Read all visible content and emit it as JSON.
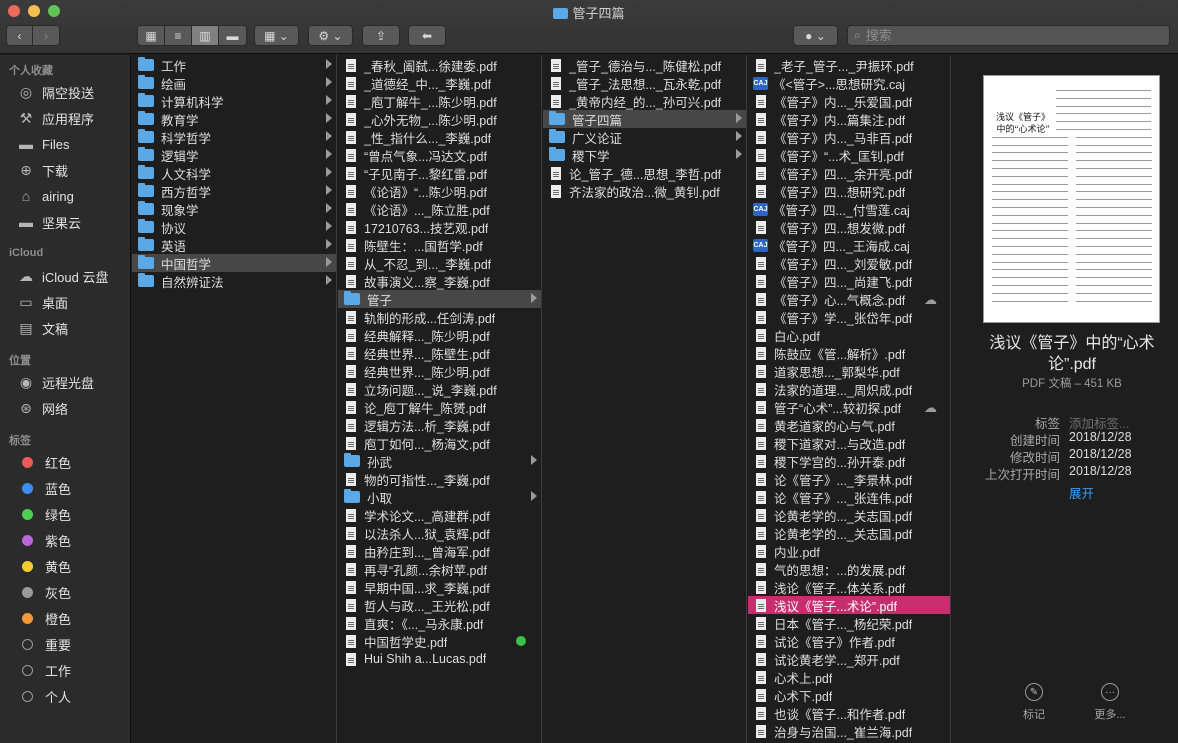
{
  "window": {
    "title": "管子四篇"
  },
  "search": {
    "placeholder": "搜索"
  },
  "sidebar": {
    "favorites_header": "个人收藏",
    "favorites": [
      {
        "label": "隔空投送",
        "icon": "airdrop-icon"
      },
      {
        "label": "应用程序",
        "icon": "applications-icon"
      },
      {
        "label": "Files",
        "icon": "folder-icon"
      },
      {
        "label": "下载",
        "icon": "downloads-icon"
      },
      {
        "label": "airing",
        "icon": "home-icon"
      },
      {
        "label": "坚果云",
        "icon": "folder-icon"
      }
    ],
    "icloud_header": "iCloud",
    "icloud": [
      {
        "label": "iCloud 云盘",
        "icon": "cloud-icon"
      },
      {
        "label": "桌面",
        "icon": "desktop-icon"
      },
      {
        "label": "文稿",
        "icon": "documents-icon"
      }
    ],
    "locations_header": "位置",
    "locations": [
      {
        "label": "远程光盘",
        "icon": "disc-icon"
      },
      {
        "label": "网络",
        "icon": "network-icon"
      }
    ],
    "tags_header": "标签",
    "tags": [
      {
        "label": "红色",
        "color": "#ec5b56"
      },
      {
        "label": "蓝色",
        "color": "#3d8ff7"
      },
      {
        "label": "绿色",
        "color": "#4fcf52"
      },
      {
        "label": "紫色",
        "color": "#b866d8"
      },
      {
        "label": "黄色",
        "color": "#f5cc30"
      },
      {
        "label": "灰色",
        "color": "#9a9a9a"
      },
      {
        "label": "橙色",
        "color": "#f29a35"
      },
      {
        "label": "重要",
        "color": ""
      },
      {
        "label": "工作",
        "color": ""
      },
      {
        "label": "个人",
        "color": ""
      }
    ]
  },
  "columns": [
    {
      "items": [
        {
          "name": "工作",
          "type": "folder"
        },
        {
          "name": "绘画",
          "type": "folder"
        },
        {
          "name": "计算机科学",
          "type": "folder"
        },
        {
          "name": "教育学",
          "type": "folder"
        },
        {
          "name": "科学哲学",
          "type": "folder"
        },
        {
          "name": "逻辑学",
          "type": "folder"
        },
        {
          "name": "人文科学",
          "type": "folder"
        },
        {
          "name": "西方哲学",
          "type": "folder"
        },
        {
          "name": "现象学",
          "type": "folder"
        },
        {
          "name": "协议",
          "type": "folder"
        },
        {
          "name": "英语",
          "type": "folder"
        },
        {
          "name": "中国哲学",
          "type": "folder",
          "selected": true
        },
        {
          "name": "自然辨证法",
          "type": "folder"
        }
      ]
    },
    {
      "items": [
        {
          "name": "_春秋_阖弑...徐建委.pdf",
          "type": "pdf"
        },
        {
          "name": "_道德经_中..._李巍.pdf",
          "type": "pdf"
        },
        {
          "name": "_庖丁解牛_...陈少明.pdf",
          "type": "pdf"
        },
        {
          "name": "_心外无物_...陈少明.pdf",
          "type": "pdf"
        },
        {
          "name": "_性_指什么..._李巍.pdf",
          "type": "pdf"
        },
        {
          "name": "“曾点气象...冯达文.pdf",
          "type": "pdf"
        },
        {
          "name": "“子见南子...黎红雷.pdf",
          "type": "pdf"
        },
        {
          "name": "《论语》“...陈少明.pdf",
          "type": "pdf"
        },
        {
          "name": "《论语》..._陈立胜.pdf",
          "type": "pdf"
        },
        {
          "name": "17210763...技艺观.pdf",
          "type": "pdf"
        },
        {
          "name": "陈壁生：...国哲学.pdf",
          "type": "pdf"
        },
        {
          "name": "从_不忍_到..._李巍.pdf",
          "type": "pdf"
        },
        {
          "name": "故事演义...察_李巍.pdf",
          "type": "pdf"
        },
        {
          "name": "管子",
          "type": "folder",
          "selected": true
        },
        {
          "name": "轨制的形成...任剑涛.pdf",
          "type": "pdf"
        },
        {
          "name": "经典解释..._陈少明.pdf",
          "type": "pdf"
        },
        {
          "name": "经典世界..._陈壁生.pdf",
          "type": "pdf"
        },
        {
          "name": "经典世界..._陈少明.pdf",
          "type": "pdf"
        },
        {
          "name": "立场问题..._说_李巍.pdf",
          "type": "pdf"
        },
        {
          "name": "论_庖丁解牛_陈赟.pdf",
          "type": "pdf"
        },
        {
          "name": "逻辑方法...析_李巍.pdf",
          "type": "pdf"
        },
        {
          "name": "庖丁如何..._杨海文.pdf",
          "type": "pdf"
        },
        {
          "name": "孙武",
          "type": "folder"
        },
        {
          "name": "物的可指性..._李巍.pdf",
          "type": "pdf"
        },
        {
          "name": "小取",
          "type": "folder"
        },
        {
          "name": "学术论文..._高建群.pdf",
          "type": "pdf"
        },
        {
          "name": "以法杀人...狱_袁辉.pdf",
          "type": "pdf"
        },
        {
          "name": "由矜庄到..._曾海军.pdf",
          "type": "pdf"
        },
        {
          "name": "再寻“孔颜...余树苹.pdf",
          "type": "pdf"
        },
        {
          "name": "早期中国...求_李巍.pdf",
          "type": "pdf"
        },
        {
          "name": "哲人与政..._王光松.pdf",
          "type": "pdf"
        },
        {
          "name": "直爽：《..._马永康.pdf",
          "type": "pdf"
        },
        {
          "name": "中国哲学史.pdf",
          "type": "pdf",
          "tag": "#38c24a"
        },
        {
          "name": "Hui Shih a...Lucas.pdf",
          "type": "pdf"
        }
      ]
    },
    {
      "items": [
        {
          "name": "_管子_德治与..._陈健松.pdf",
          "type": "pdf"
        },
        {
          "name": "_管子_法思想..._瓦永乾.pdf",
          "type": "pdf"
        },
        {
          "name": "_黄帝内经_的..._孙可兴.pdf",
          "type": "pdf"
        },
        {
          "name": "管子四篇",
          "type": "folder",
          "selected": true
        },
        {
          "name": "广义论证",
          "type": "folder"
        },
        {
          "name": "稷下学",
          "type": "folder"
        },
        {
          "name": "论_管子_德...思想_李哲.pdf",
          "type": "pdf"
        },
        {
          "name": "齐法家的政治...微_黄钊.pdf",
          "type": "pdf"
        }
      ]
    },
    {
      "items": [
        {
          "name": "_老子_管子..._尹振环.pdf",
          "type": "pdf"
        },
        {
          "name": "《<管子>...思想研究.caj",
          "type": "caj"
        },
        {
          "name": "《管子》内..._乐爱国.pdf",
          "type": "pdf"
        },
        {
          "name": "《管子》内...篇集注.pdf",
          "type": "pdf"
        },
        {
          "name": "《管子》内..._马非百.pdf",
          "type": "pdf"
        },
        {
          "name": "《管子》“...术_匡钊.pdf",
          "type": "pdf"
        },
        {
          "name": "《管子》四..._余开亮.pdf",
          "type": "pdf"
        },
        {
          "name": "《管子》四...想研究.pdf",
          "type": "pdf"
        },
        {
          "name": "《管子》四..._付雪莲.caj",
          "type": "caj"
        },
        {
          "name": "《管子》四...想发微.pdf",
          "type": "pdf"
        },
        {
          "name": "《管子》四..._王海成.caj",
          "type": "caj"
        },
        {
          "name": "《管子》四..._刘爱敏.pdf",
          "type": "pdf"
        },
        {
          "name": "《管子》四..._尚建飞.pdf",
          "type": "pdf"
        },
        {
          "name": "《管子》心...气概念.pdf",
          "type": "pdf",
          "cloud": true
        },
        {
          "name": "《管子》学..._张岱年.pdf",
          "type": "pdf"
        },
        {
          "name": "白心.pdf",
          "type": "pdf"
        },
        {
          "name": "陈鼓应《管...解析》.pdf",
          "type": "pdf"
        },
        {
          "name": "道家思想..._郭梨华.pdf",
          "type": "pdf"
        },
        {
          "name": "法家的道理..._周炽成.pdf",
          "type": "pdf"
        },
        {
          "name": "管子“心术”...较初探.pdf",
          "type": "pdf",
          "cloud": true
        },
        {
          "name": "黄老道家的心与气.pdf",
          "type": "pdf"
        },
        {
          "name": "稷下道家对...与改造.pdf",
          "type": "pdf"
        },
        {
          "name": "稷下学宫的...孙开泰.pdf",
          "type": "pdf"
        },
        {
          "name": "论《管子》..._李景林.pdf",
          "type": "pdf"
        },
        {
          "name": "论《管子》..._张连伟.pdf",
          "type": "pdf"
        },
        {
          "name": "论黄老学的..._关志国.pdf",
          "type": "pdf"
        },
        {
          "name": "论黄老学的..._关志国.pdf",
          "type": "pdf"
        },
        {
          "name": "内业.pdf",
          "type": "pdf"
        },
        {
          "name": "气的思想：...的发展.pdf",
          "type": "pdf"
        },
        {
          "name": "浅论《管子...体关系.pdf",
          "type": "pdf"
        },
        {
          "name": "浅议《管子...术论”.pdf",
          "type": "pdf",
          "selected": true
        },
        {
          "name": "日本《管子..._杨纪荣.pdf",
          "type": "pdf"
        },
        {
          "name": "试论《管子》作者.pdf",
          "type": "pdf"
        },
        {
          "name": "试论黄老学..._郑开.pdf",
          "type": "pdf"
        },
        {
          "name": "心术上.pdf",
          "type": "pdf"
        },
        {
          "name": "心术下.pdf",
          "type": "pdf"
        },
        {
          "name": "也谈《管子...和作者.pdf",
          "type": "pdf"
        },
        {
          "name": "治身与治国..._崔兰海.pdf",
          "type": "pdf"
        }
      ]
    }
  ],
  "preview": {
    "thumb_title": "浅议《管子》中的“心术论”",
    "filename": "浅议《管子》中的“心术论”.pdf",
    "kind": "PDF 文稿 – 451 KB",
    "tags_label": "标签",
    "tags_placeholder": "添加标签...",
    "created_label": "创建时间",
    "created": "2018/12/28",
    "modified_label": "修改时间",
    "modified": "2018/12/28",
    "opened_label": "上次打开时间",
    "opened": "2018/12/28",
    "more_link": "展开",
    "action_tag": "标记",
    "action_more": "更多..."
  },
  "colors": {
    "accent": "#3b9cf5",
    "selection": "#c62e6e",
    "folder": "#5aa9e6"
  }
}
